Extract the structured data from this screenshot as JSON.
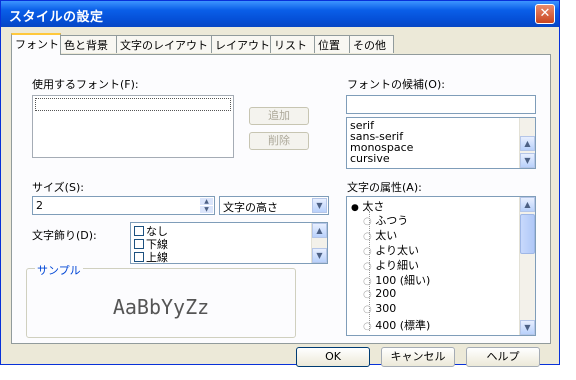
{
  "window": {
    "title": "スタイルの設定",
    "close_icon": "close-icon"
  },
  "tabs": [
    {
      "label": "フォント",
      "active": true
    },
    {
      "label": "色と背景"
    },
    {
      "label": "文字のレイアウト"
    },
    {
      "label": "レイアウト"
    },
    {
      "label": "リスト"
    },
    {
      "label": "位置"
    },
    {
      "label": "その他"
    }
  ],
  "font": {
    "label": "使用するフォント(F):",
    "add_button": "追加",
    "delete_button": "削除",
    "candidates_label": "フォントの候補(O):",
    "candidates": [
      "serif",
      "sans-serif",
      "monospace",
      "cursive"
    ]
  },
  "size": {
    "label": "サイズ(S):",
    "value": "2",
    "unit": "文字の高さ"
  },
  "decoration": {
    "label": "文字飾り(D):",
    "items": [
      "なし",
      "下線",
      "上線"
    ]
  },
  "attributes": {
    "label": "文字の属性(A):",
    "root": "太さ",
    "items": [
      "ふつう",
      "太い",
      "より太い",
      "より細い",
      "100 (細い)",
      "200",
      "300",
      "400 (標準)"
    ]
  },
  "sample": {
    "label": "サンプル",
    "text": "AaBbYyZz"
  },
  "footer": {
    "ok": "OK",
    "cancel": "キャンセル",
    "help": "ヘルプ"
  },
  "colors": {
    "titlebar": "#0550d8",
    "accent_tab": "#ffc83c",
    "link_label": "#0046d5"
  }
}
